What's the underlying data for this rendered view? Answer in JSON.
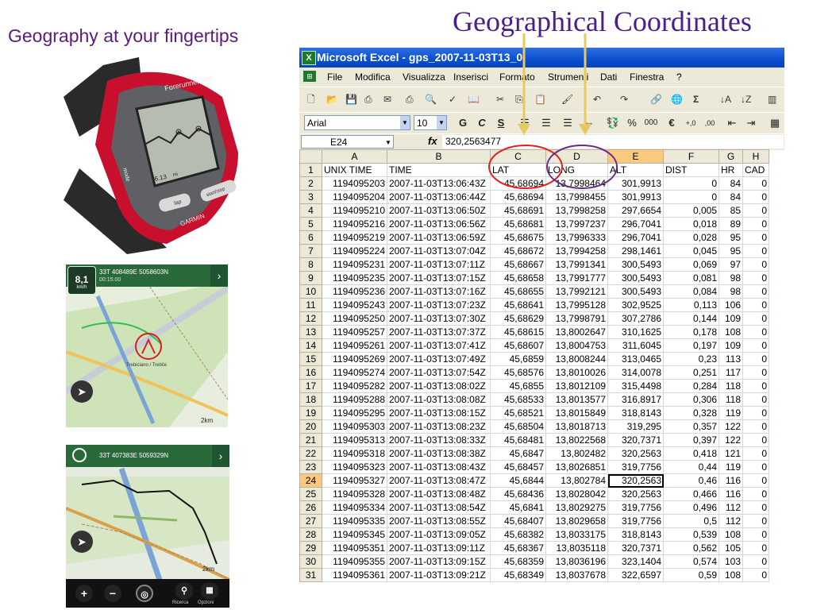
{
  "slide": {
    "title": "Geographical Coordinates",
    "subtitle": "Geography at your fingertips"
  },
  "watch": {
    "brand": "Forerunner 305",
    "maker": "GARMIN",
    "mode_label": "mode",
    "lap_label": "lap",
    "start_label": "start/stop",
    "distance": "6.13",
    "distance_unit": "mi"
  },
  "map1": {
    "coords": "33T 408489E 5058603N",
    "time": "00:15:00",
    "speed": "8,1",
    "speed_unit": "km/h",
    "scale": "2km",
    "place": "Trebiciano / Trebče"
  },
  "map2": {
    "coords": "33T 407383E 5059329N",
    "scale": "2km",
    "btn_labels": [
      "Ricerca",
      "Opzioni"
    ]
  },
  "excel": {
    "window_title": "Microsoft Excel - gps_2007-11-03T13_0",
    "menu": [
      "File",
      "Modifica",
      "Visualizza",
      "Inserisci",
      "Formato",
      "Strumenti",
      "Dati",
      "Finestra",
      "?"
    ],
    "font_name": "Arial",
    "font_size": "10",
    "format_buttons": [
      "G",
      "C",
      "S"
    ],
    "name_box": "E24",
    "fx_label": "fx",
    "formula_value": "320,2563477",
    "column_headers": [
      "A",
      "B",
      "C",
      "D",
      "E",
      "F",
      "G",
      "H"
    ],
    "selected_column": "E",
    "selected_row": "24",
    "header_row": [
      "UNIX TIME",
      "TIME",
      "LAT",
      "LONG",
      "ALT",
      "DIST",
      "HR",
      "CAD"
    ],
    "rows": [
      [
        "2",
        "1194095203",
        "2007-11-03T13:06:43Z",
        "45,68694",
        "13,7998464",
        "301,9913",
        "0",
        "84",
        "0"
      ],
      [
        "3",
        "1194095204",
        "2007-11-03T13:06:44Z",
        "45,68694",
        "13,7998455",
        "301,9913",
        "0",
        "84",
        "0"
      ],
      [
        "4",
        "1194095210",
        "2007-11-03T13:06:50Z",
        "45,68691",
        "13,7998258",
        "297,6654",
        "0,005",
        "85",
        "0"
      ],
      [
        "5",
        "1194095216",
        "2007-11-03T13:06:56Z",
        "45,68681",
        "13,7997237",
        "296,7041",
        "0,018",
        "89",
        "0"
      ],
      [
        "6",
        "1194095219",
        "2007-11-03T13:06:59Z",
        "45,68675",
        "13,7996333",
        "296,7041",
        "0,028",
        "95",
        "0"
      ],
      [
        "7",
        "1194095224",
        "2007-11-03T13:07:04Z",
        "45,68672",
        "13,7994258",
        "298,1461",
        "0,045",
        "95",
        "0"
      ],
      [
        "8",
        "1194095231",
        "2007-11-03T13:07:11Z",
        "45,68667",
        "13,7991341",
        "300,5493",
        "0,069",
        "97",
        "0"
      ],
      [
        "9",
        "1194095235",
        "2007-11-03T13:07:15Z",
        "45,68658",
        "13,7991777",
        "300,5493",
        "0,081",
        "98",
        "0"
      ],
      [
        "10",
        "1194095236",
        "2007-11-03T13:07:16Z",
        "45,68655",
        "13,7992121",
        "300,5493",
        "0,084",
        "98",
        "0"
      ],
      [
        "11",
        "1194095243",
        "2007-11-03T13:07:23Z",
        "45,68641",
        "13,7995128",
        "302,9525",
        "0,113",
        "106",
        "0"
      ],
      [
        "12",
        "1194095250",
        "2007-11-03T13:07:30Z",
        "45,68629",
        "13,7998791",
        "307,2786",
        "0,144",
        "109",
        "0"
      ],
      [
        "13",
        "1194095257",
        "2007-11-03T13:07:37Z",
        "45,68615",
        "13,8002647",
        "310,1625",
        "0,178",
        "108",
        "0"
      ],
      [
        "14",
        "1194095261",
        "2007-11-03T13:07:41Z",
        "45,68607",
        "13,8004753",
        "311,6045",
        "0,197",
        "109",
        "0"
      ],
      [
        "15",
        "1194095269",
        "2007-11-03T13:07:49Z",
        "45,6859",
        "13,8008244",
        "313,0465",
        "0,23",
        "113",
        "0"
      ],
      [
        "16",
        "1194095274",
        "2007-11-03T13:07:54Z",
        "45,68576",
        "13,8010026",
        "314,0078",
        "0,251",
        "117",
        "0"
      ],
      [
        "17",
        "1194095282",
        "2007-11-03T13:08:02Z",
        "45,6855",
        "13,8012109",
        "315,4498",
        "0,284",
        "118",
        "0"
      ],
      [
        "18",
        "1194095288",
        "2007-11-03T13:08:08Z",
        "45,68533",
        "13,8013577",
        "316,8917",
        "0,306",
        "118",
        "0"
      ],
      [
        "19",
        "1194095295",
        "2007-11-03T13:08:15Z",
        "45,68521",
        "13,8015849",
        "318,8143",
        "0,328",
        "119",
        "0"
      ],
      [
        "20",
        "1194095303",
        "2007-11-03T13:08:23Z",
        "45,68504",
        "13,8018713",
        "319,295",
        "0,357",
        "122",
        "0"
      ],
      [
        "21",
        "1194095313",
        "2007-11-03T13:08:33Z",
        "45,68481",
        "13,8022568",
        "320,7371",
        "0,397",
        "122",
        "0"
      ],
      [
        "22",
        "1194095318",
        "2007-11-03T13:08:38Z",
        "45,6847",
        "13,802482",
        "320,2563",
        "0,418",
        "121",
        "0"
      ],
      [
        "23",
        "1194095323",
        "2007-11-03T13:08:43Z",
        "45,68457",
        "13,8026851",
        "319,7756",
        "0,44",
        "119",
        "0"
      ],
      [
        "24",
        "1194095327",
        "2007-11-03T13:08:47Z",
        "45,6844",
        "13,802784",
        "320,2563",
        "0,46",
        "116",
        "0"
      ],
      [
        "25",
        "1194095328",
        "2007-11-03T13:08:48Z",
        "45,68436",
        "13,8028042",
        "320,2563",
        "0,466",
        "116",
        "0"
      ],
      [
        "26",
        "1194095334",
        "2007-11-03T13:08:54Z",
        "45,6841",
        "13,8029275",
        "319,7756",
        "0,496",
        "112",
        "0"
      ],
      [
        "27",
        "1194095335",
        "2007-11-03T13:08:55Z",
        "45,68407",
        "13,8029658",
        "319,7756",
        "0,5",
        "112",
        "0"
      ],
      [
        "28",
        "1194095345",
        "2007-11-03T13:09:05Z",
        "45,68382",
        "13,8033175",
        "318,8143",
        "0,539",
        "108",
        "0"
      ],
      [
        "29",
        "1194095351",
        "2007-11-03T13:09:11Z",
        "45,68367",
        "13,8035118",
        "320,7371",
        "0,562",
        "105",
        "0"
      ],
      [
        "30",
        "1194095355",
        "2007-11-03T13:09:15Z",
        "45,68359",
        "13,8036196",
        "323,1404",
        "0,574",
        "103",
        "0"
      ],
      [
        "31",
        "1194095361",
        "2007-11-03T13:09:21Z",
        "45,68349",
        "13,8037678",
        "322,6597",
        "0,59",
        "108",
        "0"
      ]
    ]
  },
  "colors": {
    "title": "#4a1f8a",
    "subtitle": "#5a1c7a",
    "lat_circle": "#e02020",
    "long_circle": "#6a2a8a",
    "arrow": "#e8c860",
    "excel_titlebar": "#0a4fd0"
  }
}
